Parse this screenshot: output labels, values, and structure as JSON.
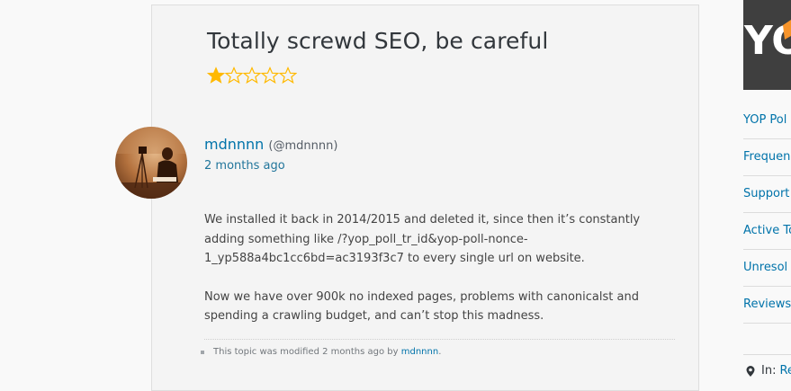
{
  "review": {
    "title": "Totally screwd SEO, be careful",
    "rating": {
      "value": 1,
      "max": 5,
      "filled_color": "#ffb900",
      "empty_color": "#ffb900"
    },
    "author_name": "mdnnnn",
    "author_handle": "(@mdnnnn)",
    "date": "2 months ago",
    "paragraphs": [
      "We installed it back in 2014/2015 and deleted it, since then it’s constantly adding something like /?yop_poll_tr_id&yop-poll-nonce-1_yp588a4bc1cc6bd=ac3193f3c7 to every single url on website.",
      "Now we have over 900k no indexed pages, problems with canonicalst and spending a crawling budget, and can’t stop this madness."
    ],
    "modified_prefix": "This topic was modified 2 months ago by",
    "modified_by": "mdnnnn",
    "modified_suffix": "."
  },
  "sidebar": {
    "banner_text": "YO",
    "links": [
      {
        "label": "YOP Pol"
      },
      {
        "label": "Frequen"
      },
      {
        "label": "Support"
      },
      {
        "label": "Active To"
      },
      {
        "label": "Unresol"
      },
      {
        "label": "Reviews"
      }
    ],
    "in_label": "In:",
    "in_link": "Re"
  },
  "colors": {
    "link": "#0073aa",
    "text": "#32373c",
    "star": "#ffb900",
    "banner_bg": "#3f3f3f",
    "banner_accent": "#f7942a"
  }
}
